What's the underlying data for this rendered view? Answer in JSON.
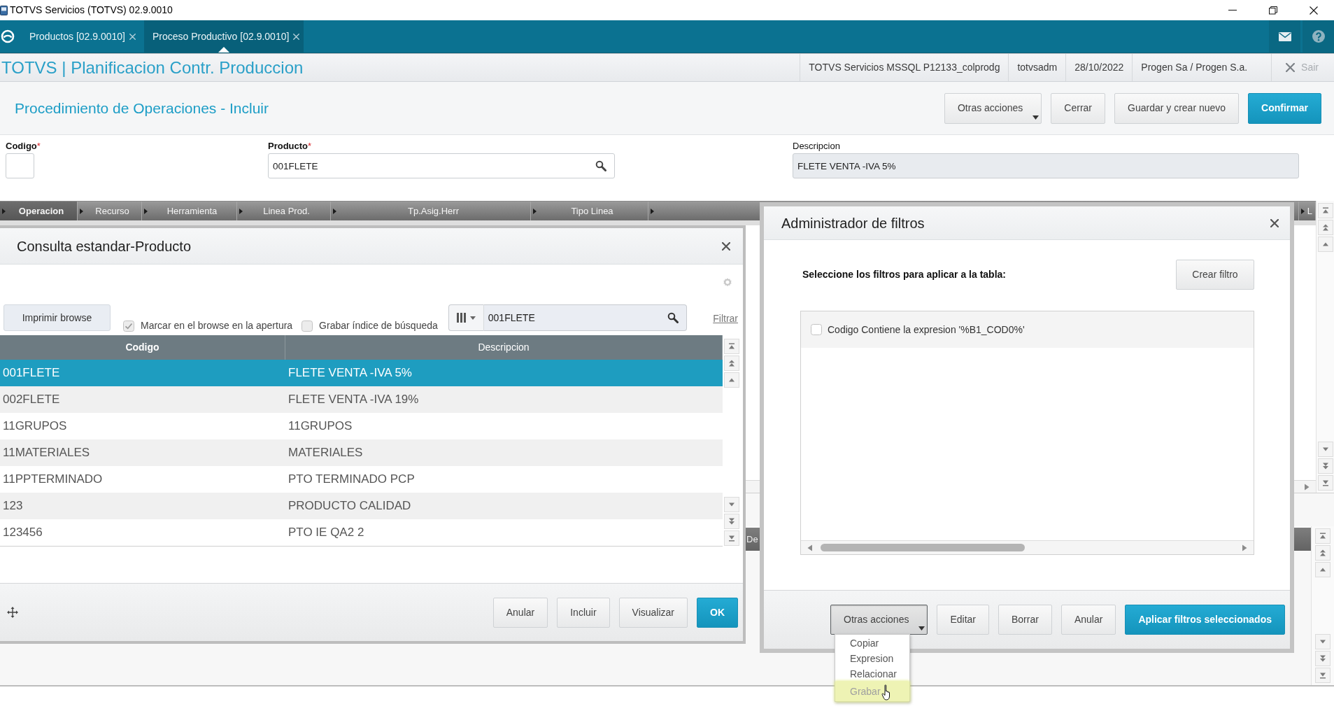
{
  "window": {
    "title": "TOTVS Servicios (TOTVS) 02.9.0010"
  },
  "app_tabs": [
    {
      "label": "Productos [02.9.0010]",
      "selected": false
    },
    {
      "label": "Proceso Productivo [02.9.0010]",
      "selected": true
    }
  ],
  "header": {
    "title": "TOTVS | Planificacion Contr. Produccion",
    "info": [
      "TOTVS Servicios MSSQL P12133_colprodg",
      "totvsadm",
      "28/10/2022",
      "Progen Sa / Progen S.a."
    ],
    "exit_label": "Sair"
  },
  "page": {
    "title": "Procedimiento de Operaciones - Incluir",
    "buttons": [
      {
        "label": "Otras acciones",
        "kind": "dropdown",
        "expanded": false
      },
      {
        "label": "Cerrar",
        "kind": "default"
      },
      {
        "label": "Guardar y crear nuevo",
        "kind": "default"
      },
      {
        "label": "Confirmar",
        "kind": "primary"
      }
    ]
  },
  "form": {
    "fields": [
      {
        "label": "Codigo",
        "required_mark": "*",
        "kind": "short"
      },
      {
        "label": "Producto",
        "required_mark": "*",
        "kind": "lookup",
        "value": "001FLETE"
      },
      {
        "label": "Descripcion",
        "kind": "readonly",
        "value": "FLETE VENTA -IVA 5%"
      }
    ]
  },
  "section_tabs": [
    {
      "label": "Operacion",
      "selected": true
    },
    {
      "label": "Recurso",
      "selected": false
    },
    {
      "label": "Herramienta",
      "selected": false
    },
    {
      "label": "Linea Prod.",
      "selected": false
    },
    {
      "label": "Tp.Asig.Herr",
      "selected": false
    },
    {
      "label": "Tipo Linea",
      "selected": false
    },
    {
      "label": "L",
      "selected": false
    }
  ],
  "lower_grid": {
    "columns": [
      "De"
    ]
  },
  "lookup_dialog": {
    "title": "Consulta estandar-Producto",
    "print_button": "Imprimir browse",
    "options": [
      {
        "label": "Marcar en el browse en la apertura",
        "checked": true
      },
      {
        "label": "Grabar índice de búsqueda",
        "checked": false
      }
    ],
    "search": {
      "value": "001FLETE"
    },
    "filter_link": "Filtrar",
    "columns": [
      {
        "label": "Codigo",
        "sorted": true
      },
      {
        "label": "Descripcion",
        "sorted": false
      }
    ],
    "rows": [
      {
        "cells": [
          "001FLETE",
          "FLETE VENTA -IVA 5%"
        ],
        "selected": true
      },
      {
        "cells": [
          "002FLETE",
          "FLETE VENTA -IVA 19%"
        ],
        "selected": false
      },
      {
        "cells": [
          "11GRUPOS",
          "11GRUPOS"
        ],
        "selected": false
      },
      {
        "cells": [
          "11MATERIALES",
          "MATERIALES"
        ],
        "selected": false
      },
      {
        "cells": [
          "11PPTERMINADO",
          "PTO TERMINADO PCP"
        ],
        "selected": false
      },
      {
        "cells": [
          "123",
          "PRODUCTO CALIDAD"
        ],
        "selected": false
      },
      {
        "cells": [
          "123456",
          "PTO IE QA2 2"
        ],
        "selected": false
      }
    ],
    "buttons": [
      {
        "label": "Anular",
        "kind": "default"
      },
      {
        "label": "Incluir",
        "kind": "default"
      },
      {
        "label": "Visualizar",
        "kind": "default"
      },
      {
        "label": "OK",
        "kind": "primary"
      }
    ]
  },
  "filter_dialog": {
    "title": "Administrador de filtros",
    "prompt": "Seleccione los filtros para aplicar a la tabla:",
    "create_button": "Crear filtro",
    "filters": [
      {
        "label": "Codigo Contiene la expresion '%B1_COD0%'",
        "checked": false
      }
    ],
    "buttons": [
      {
        "label": "Otras acciones",
        "kind": "dropdown",
        "expanded": true
      },
      {
        "label": "Editar",
        "kind": "default"
      },
      {
        "label": "Borrar",
        "kind": "default"
      },
      {
        "label": "Anular",
        "kind": "default"
      },
      {
        "label": "Aplicar filtros seleccionados",
        "kind": "primary"
      }
    ],
    "menu": [
      {
        "label": "Copiar",
        "highlighted": false
      },
      {
        "label": "Expresion",
        "highlighted": false
      },
      {
        "label": "Relacionar",
        "highlighted": false
      },
      {
        "label": "Grabar",
        "highlighted": true
      }
    ]
  }
}
